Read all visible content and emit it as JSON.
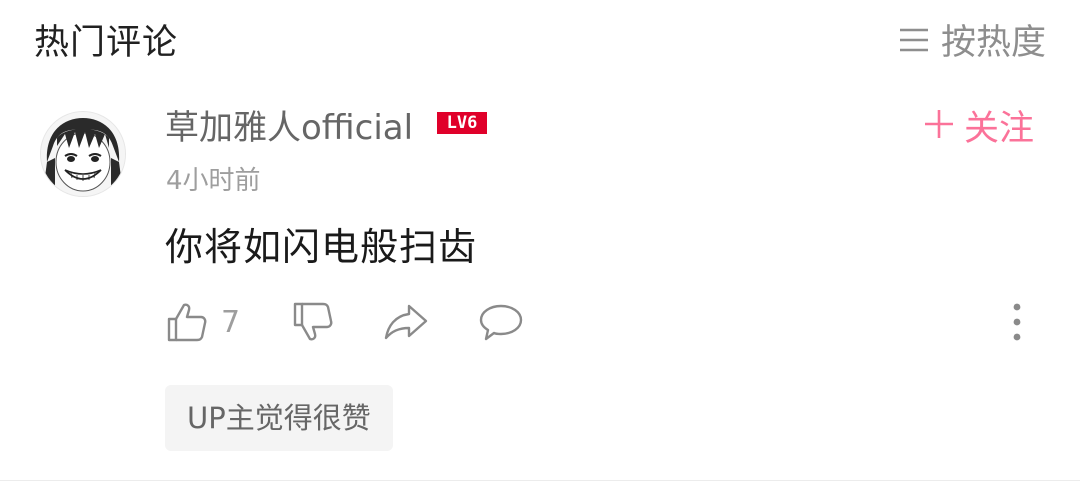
{
  "header": {
    "title": "热门评论",
    "sort_label": "按热度",
    "sort_icon": "menu-lines-icon"
  },
  "comment": {
    "username": "草加雅人official",
    "level": "LV6",
    "follow_label": "关注",
    "timestamp": "4小时前",
    "content": "你将如闪电般扫齿",
    "likes": "7",
    "up_tag": "UP主觉得很赞"
  },
  "colors": {
    "accent_pink": "#fb7299",
    "level_red": "#e0002a",
    "muted_gray": "#9e9e9e"
  }
}
